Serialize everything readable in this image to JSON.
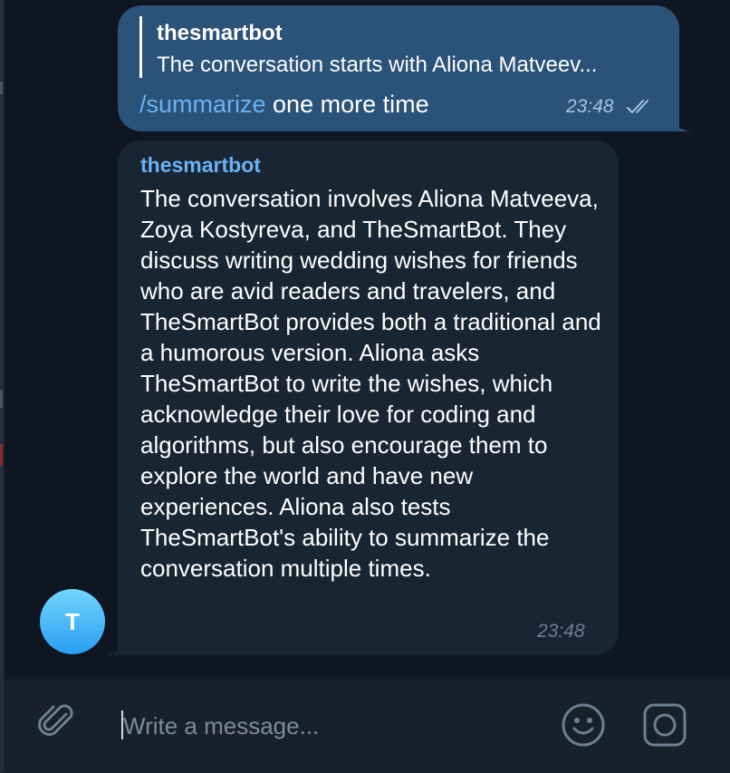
{
  "chat": {
    "outgoing": {
      "reply_to_name": "thesmartbot",
      "reply_to_text": "The conversation starts with Aliona Matveev...",
      "command": "/summarize",
      "text": " one more time",
      "time": "23:48",
      "status_icon": "double-check-icon"
    },
    "incoming": {
      "sender": "thesmartbot",
      "text": "The conversation involves Aliona Matveeva, Zoya Kostyreva, and TheSmartBot. They discuss writing wedding wishes for friends who are avid readers and travelers, and TheSmartBot provides both a traditional and a humorous version. Aliona asks TheSmartBot to write the wishes, which acknowledge their love for coding and algorithms, but also encourage them to explore the world and have new experiences. Aliona also tests TheSmartBot's ability to summarize the conversation multiple times.",
      "time": "23:48",
      "avatar_letter": "T"
    }
  },
  "composer": {
    "placeholder": "Write a message...",
    "value": "",
    "icons": {
      "attach": "paperclip-icon",
      "emoji": "smile-icon",
      "camera": "instagram-camera-icon"
    }
  },
  "colors": {
    "chat_background": "#0e1621",
    "outgoing_bubble": "#2b5278",
    "incoming_bubble": "#182533",
    "accent": "#6ab3f3",
    "composer_background": "#17212b"
  }
}
